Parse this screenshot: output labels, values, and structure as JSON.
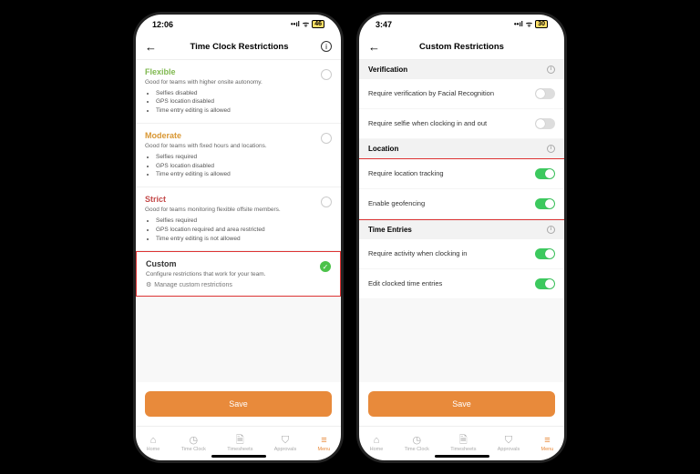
{
  "left": {
    "time": "12:06",
    "battery": "46",
    "title": "Time Clock Restrictions",
    "flexible": {
      "title": "Flexible",
      "sub": "Good for teams with higher onsite autonomy.",
      "b1": "Selfies disabled",
      "b2": "GPS location disabled",
      "b3": "Time entry editing is allowed"
    },
    "moderate": {
      "title": "Moderate",
      "sub": "Good for teams with fixed hours and locations.",
      "b1": "Selfies required",
      "b2": "GPS location disabled",
      "b3": "Time entry editing is allowed"
    },
    "strict": {
      "title": "Strict",
      "sub": "Good for teams monitoring flexible offsite members.",
      "b1": "Selfies required",
      "b2": "GPS location required and area restricted",
      "b3": "Time entry editing is not allowed"
    },
    "custom": {
      "title": "Custom",
      "sub": "Configure restrictions that work for your team.",
      "manage": "Manage custom restrictions"
    },
    "save": "Save"
  },
  "right": {
    "time": "3:47",
    "battery": "30",
    "title": "Custom Restrictions",
    "verification": {
      "head": "Verification",
      "r1": "Require verification by Facial Recognition",
      "r2": "Require selfie when clocking in and out"
    },
    "location": {
      "head": "Location",
      "r1": "Require location tracking",
      "r2": "Enable geofencing"
    },
    "timeentries": {
      "head": "Time Entries",
      "r1": "Require activity when clocking in",
      "r2": "Edit clocked time entries"
    },
    "save": "Save"
  },
  "tabs": {
    "home": "Home",
    "timeclock": "Time Clock",
    "timesheets": "Timesheets",
    "approvals": "Approvals",
    "menu": "Menu"
  }
}
